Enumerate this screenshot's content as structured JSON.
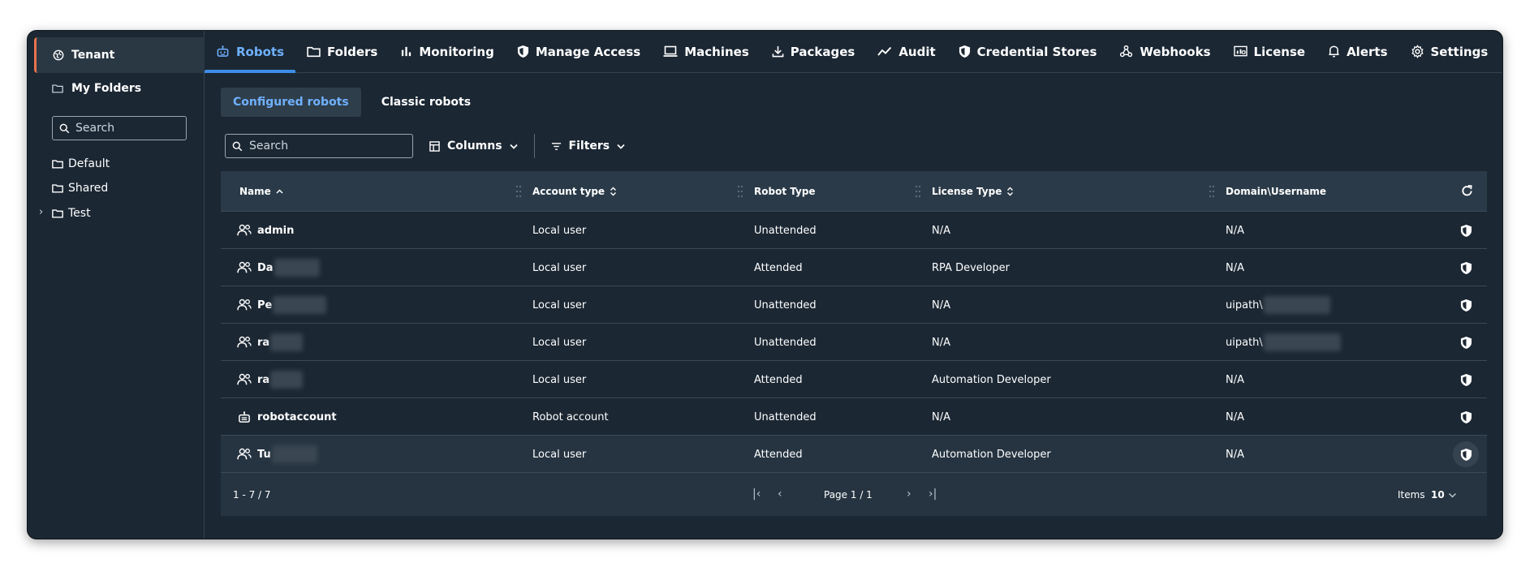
{
  "sidebar": {
    "tenant_label": "Tenant",
    "my_folders_label": "My Folders",
    "search_placeholder": "Search",
    "folders": [
      {
        "label": "Default"
      },
      {
        "label": "Shared"
      },
      {
        "label": "Test",
        "expandable": true
      }
    ]
  },
  "nav": {
    "tabs": [
      {
        "label": "Robots",
        "icon": "robot-icon",
        "active": true
      },
      {
        "label": "Folders",
        "icon": "folder-icon"
      },
      {
        "label": "Monitoring",
        "icon": "bar-chart-icon"
      },
      {
        "label": "Manage Access",
        "icon": "shield-icon"
      },
      {
        "label": "Machines",
        "icon": "laptop-icon"
      },
      {
        "label": "Packages",
        "icon": "download-icon"
      },
      {
        "label": "Audit",
        "icon": "trend-icon"
      },
      {
        "label": "Credential Stores",
        "icon": "shield-icon"
      },
      {
        "label": "Webhooks",
        "icon": "webhook-icon"
      },
      {
        "label": "License",
        "icon": "license-icon"
      },
      {
        "label": "Alerts",
        "icon": "bell-icon"
      },
      {
        "label": "Settings",
        "icon": "gear-icon"
      }
    ]
  },
  "subtabs": {
    "configured": "Configured robots",
    "classic": "Classic robots"
  },
  "toolbar": {
    "search_placeholder": "Search",
    "columns_label": "Columns",
    "filters_label": "Filters"
  },
  "table": {
    "headers": {
      "name": "Name",
      "account_type": "Account type",
      "robot_type": "Robot Type",
      "license_type": "License Type",
      "domain_username": "Domain\\Username"
    },
    "rows": [
      {
        "name": "admin",
        "name_redacted": false,
        "account_type": "Local user",
        "robot_type": "Unattended",
        "license_type": "N/A",
        "domain": "N/A",
        "domain_redacted": false,
        "icon": "user-group-icon"
      },
      {
        "name": "Da",
        "name_redacted": true,
        "account_type": "Local user",
        "robot_type": "Attended",
        "license_type": "RPA Developer",
        "domain": "N/A",
        "domain_redacted": false,
        "icon": "user-group-icon"
      },
      {
        "name": "Pe",
        "name_redacted": true,
        "account_type": "Local user",
        "robot_type": "Unattended",
        "license_type": "N/A",
        "domain": "uipath\\",
        "domain_redacted": true,
        "icon": "user-group-icon"
      },
      {
        "name": "ra",
        "name_redacted": true,
        "account_type": "Local user",
        "robot_type": "Unattended",
        "license_type": "N/A",
        "domain": "uipath\\",
        "domain_redacted": true,
        "icon": "user-group-icon"
      },
      {
        "name": "ra",
        "name_redacted": true,
        "account_type": "Local user",
        "robot_type": "Attended",
        "license_type": "Automation Developer",
        "domain": "N/A",
        "domain_redacted": false,
        "icon": "user-group-icon"
      },
      {
        "name": "robotaccount",
        "name_redacted": false,
        "account_type": "Robot account",
        "robot_type": "Unattended",
        "license_type": "N/A",
        "domain": "N/A",
        "domain_redacted": false,
        "icon": "robot-icon"
      },
      {
        "name": "Tu",
        "name_redacted": true,
        "account_type": "Local user",
        "robot_type": "Attended",
        "license_type": "Automation Developer",
        "domain": "N/A",
        "domain_redacted": false,
        "icon": "user-group-icon",
        "hover": true
      }
    ]
  },
  "footer": {
    "range": "1 - 7 / 7",
    "page": "Page 1 / 1",
    "items_label": "Items",
    "items_value": "10"
  }
}
